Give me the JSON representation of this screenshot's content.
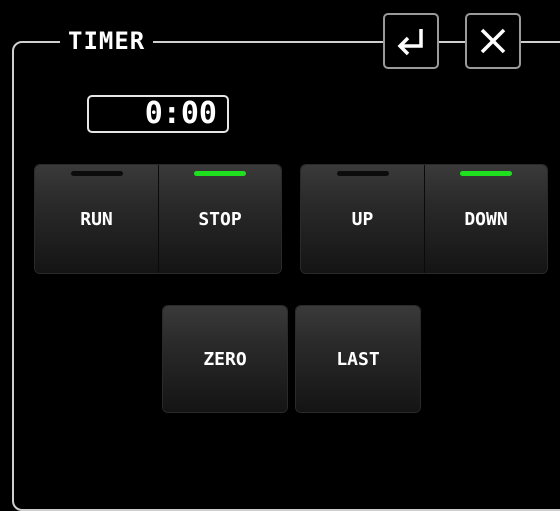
{
  "panel": {
    "title": "TIMER"
  },
  "header": {
    "enter_icon": "enter-arrow-icon",
    "close_icon": "close-x-icon"
  },
  "timer": {
    "display": "0:00"
  },
  "mode_buttons": {
    "run": {
      "label": "RUN",
      "active": false
    },
    "stop": {
      "label": "STOP",
      "active": true
    },
    "up": {
      "label": "UP",
      "active": false
    },
    "down": {
      "label": "DOWN",
      "active": true
    }
  },
  "action_buttons": {
    "zero": {
      "label": "ZERO"
    },
    "last": {
      "label": "LAST"
    }
  },
  "colors": {
    "indicator_on": "#1fe01f",
    "indicator_off": "#0c0c0c",
    "background": "#000000"
  }
}
